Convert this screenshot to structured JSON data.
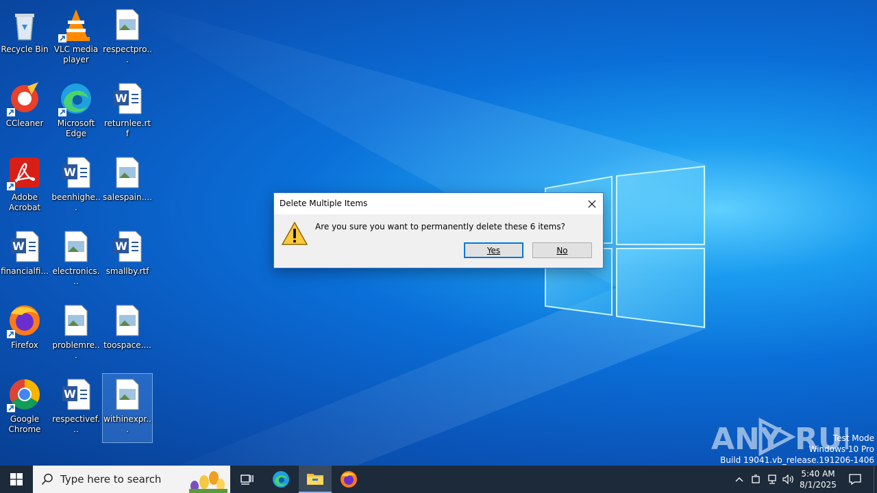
{
  "desktop": {
    "icons": [
      {
        "label": "Recycle Bin",
        "icon": "recycle-bin-icon"
      },
      {
        "label": "VLC media player",
        "icon": "vlc-icon"
      },
      {
        "label": "respectpro...",
        "icon": "image-file-icon"
      },
      {
        "label": "CCleaner",
        "icon": "ccleaner-icon"
      },
      {
        "label": "Microsoft Edge",
        "icon": "edge-icon"
      },
      {
        "label": "returnlee.rtf",
        "icon": "word-doc-icon"
      },
      {
        "label": "Adobe Acrobat",
        "icon": "acrobat-icon"
      },
      {
        "label": "beenhighe...",
        "icon": "word-doc-icon"
      },
      {
        "label": "salespain....",
        "icon": "image-file-icon"
      },
      {
        "label": "financialfi...",
        "icon": "word-doc-icon"
      },
      {
        "label": "electronics...",
        "icon": "image-file-icon"
      },
      {
        "label": "smallby.rtf",
        "icon": "word-doc-icon"
      },
      {
        "label": "Firefox",
        "icon": "firefox-icon"
      },
      {
        "label": "problemre...",
        "icon": "image-file-icon"
      },
      {
        "label": "toospace....",
        "icon": "image-file-icon"
      },
      {
        "label": "Google Chrome",
        "icon": "chrome-icon"
      },
      {
        "label": "respectivef...",
        "icon": "word-doc-icon"
      },
      {
        "label": "withinexpr...",
        "icon": "image-file-icon"
      }
    ]
  },
  "dialog": {
    "title": "Delete Multiple Items",
    "message": "Are you sure you want to permanently delete these 6 items?",
    "yes_label": "Yes",
    "no_label": "No"
  },
  "watermark": {
    "line1": "Test Mode",
    "line2": "Windows 10 Pro",
    "line3": "Build 19041.vb_release.191206-1406",
    "brand": "ANY RUN"
  },
  "taskbar": {
    "search_placeholder": "Type here to search",
    "time": "5:40 AM",
    "date": "8/1/2025"
  },
  "colors": {
    "accent": "#0078d7",
    "taskbar": "#1c2a3a"
  }
}
